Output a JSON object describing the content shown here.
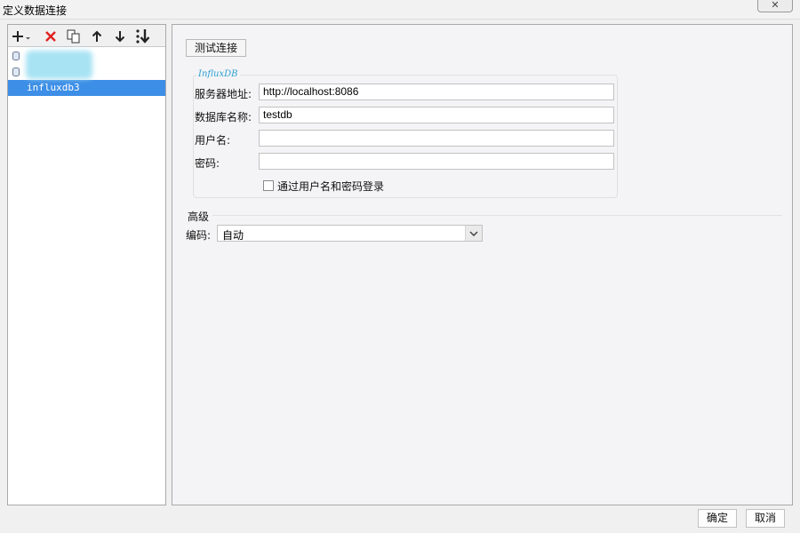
{
  "window": {
    "title": "定义数据连接",
    "close_glyph": "✕"
  },
  "toolbar": {
    "add_icon": "plus-dropdown-icon",
    "delete_icon": "red-x-delete-icon",
    "copy_icon": "copy-icon",
    "move_up_icon": "arrow-up-icon",
    "move_down_icon": "arrow-down-icon",
    "sort_icon": "sort-down-icon"
  },
  "connections": [
    {
      "name": "",
      "icon": "database-icon",
      "redacted": true
    },
    {
      "name": "",
      "icon": "database-icon",
      "redacted": true
    },
    {
      "name": "influxdb3",
      "selected": true
    }
  ],
  "main": {
    "test_button_label": "测试连接",
    "group_title": "InfluxDB",
    "fields": {
      "server_label": "服务器地址:",
      "server_value": "http://localhost:8086",
      "database_label": "数据库名称:",
      "database_value": "testdb",
      "user_label": "用户名:",
      "user_value": "",
      "password_label": "密码:",
      "password_value": ""
    },
    "auth_checkbox_label": "通过用户名和密码登录",
    "auth_checked": false,
    "advanced_label": "高级",
    "encoding_label": "编码:",
    "encoding_value": "自动"
  },
  "footer": {
    "ok_label": "确定",
    "cancel_label": "取消"
  },
  "colors": {
    "selection": "#3d8ee6",
    "group_title": "#2a9fcf",
    "delete_red": "#e02020"
  }
}
